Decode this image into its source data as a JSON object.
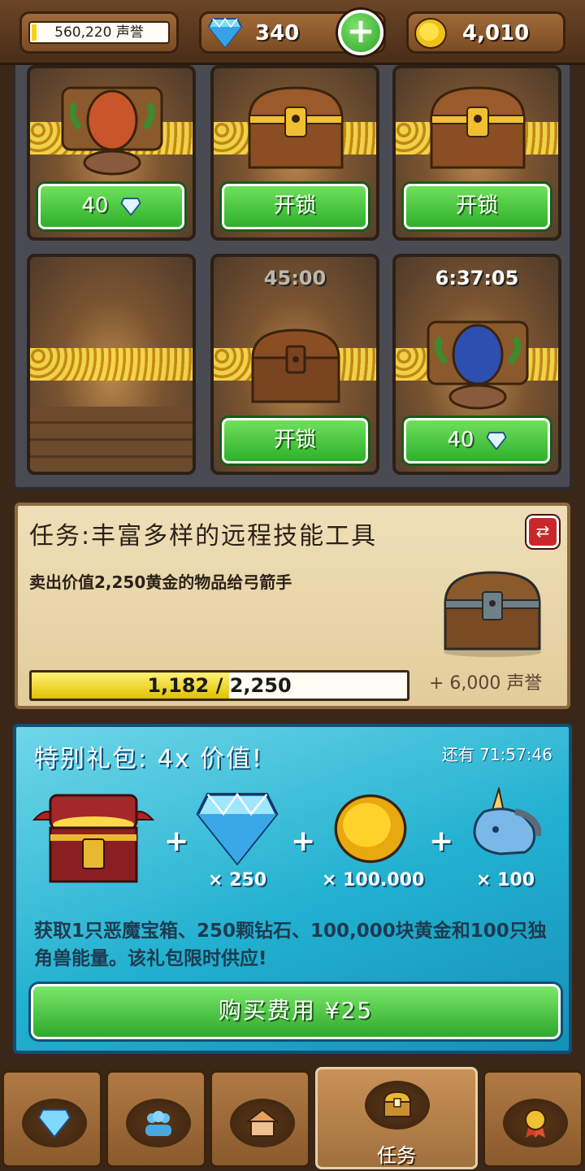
{
  "top_bar": {
    "reputation_text": "560,220 声誉",
    "gems": "340",
    "gold": "4,010",
    "add_gems_label": "+"
  },
  "chest_slots": [
    {
      "timer": "",
      "button_label": "40",
      "button_has_gem": true,
      "content": "monster-bag-orange"
    },
    {
      "timer": "",
      "button_label": "开锁",
      "button_has_gem": false,
      "content": "gold-chest"
    },
    {
      "timer": "",
      "button_label": "开锁",
      "button_has_gem": false,
      "content": "gold-chest"
    },
    {
      "timer": "",
      "button_label": "",
      "button_has_gem": false,
      "content": "empty"
    },
    {
      "timer": "45:00",
      "button_label": "开锁",
      "button_has_gem": false,
      "content": "wooden-chest"
    },
    {
      "timer": "6:37:05",
      "button_label": "40",
      "button_has_gem": true,
      "content": "monster-bag-blue"
    }
  ],
  "quest": {
    "title": "任务:丰富多样的远程技能工具",
    "description": "卖出价值2,250黄金的物品给弓箭手",
    "progress_text": "1,182 / 2,250",
    "progress_current": 1182,
    "progress_total": 2250,
    "reward_text": "+ 6,000 声誉"
  },
  "offer": {
    "title": "特别礼包: 4x 价值!",
    "timer": "还有 71:57:46",
    "items": [
      {
        "icon": "demon-chest-icon",
        "qty": ""
      },
      {
        "icon": "diamond-icon",
        "qty": "× 250"
      },
      {
        "icon": "gold-coin-icon",
        "qty": "× 100.000"
      },
      {
        "icon": "unicorn-icon",
        "qty": "× 100"
      }
    ],
    "description": "获取1只恶魔宝箱、250颗钻石、100,000块黄金和100只独角兽能量。该礼包限时供应!",
    "buy_label": "购买费用 ¥25"
  },
  "bottom_nav": [
    {
      "icon": "gems-icon",
      "label": ""
    },
    {
      "icon": "people-icon",
      "label": ""
    },
    {
      "icon": "shop-icon",
      "label": ""
    },
    {
      "icon": "chest-icon",
      "label": "任务",
      "active": true
    },
    {
      "icon": "medal-icon",
      "label": ""
    }
  ],
  "colors": {
    "accent_green": "#2fb02b",
    "offer_blue": "#21b0d0",
    "progress_yellow": "#e0c200"
  }
}
